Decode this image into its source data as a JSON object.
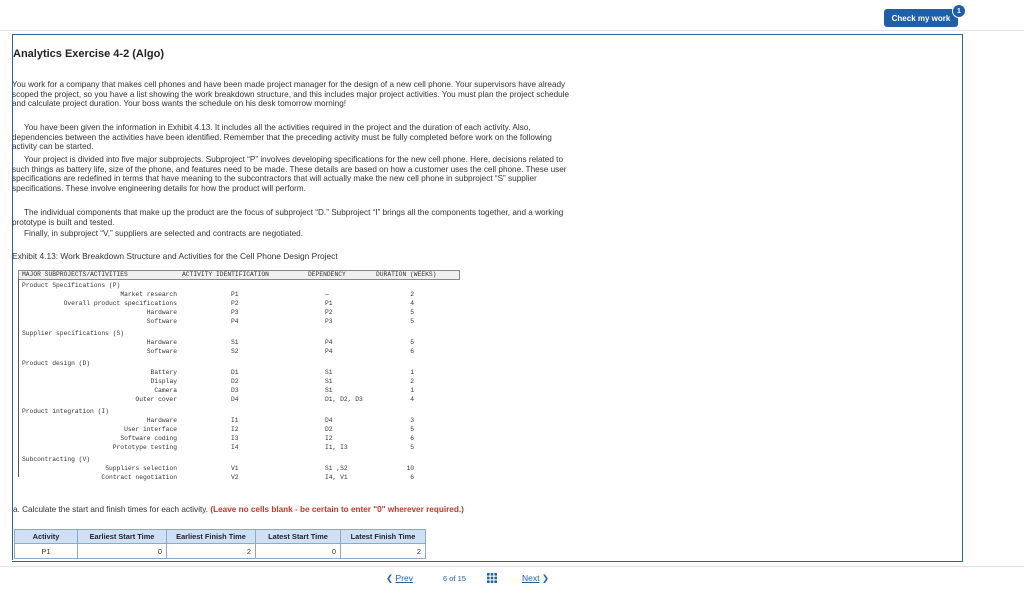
{
  "header": {
    "check_label": "Check my work",
    "badge_count": "1"
  },
  "title": "Analytics Exercise 4-2 (Algo)",
  "paragraphs": [
    "You work for a company that makes cell phones and have been made project manager for the design of a new cell phone. Your supervisors have already scoped the project, so you have a list showing the work breakdown structure, and this includes major project activities. You must plan the project schedule and calculate project duration. Your boss wants the schedule on his desk tomorrow morning!",
    "You have been given the information in Exhibit 4.13. It includes all the activities required in the project and the duration of each activity. Also, dependencies between the activities have been identified. Remember that the preceding activity must be fully completed before work on the following activity can be started.",
    "Your project is divided into five major subprojects. Subproject “P” involves developing specifications for the new cell phone. Here, decisions related to such things as battery life, size of the phone, and features need to be made. These details are based on how a customer uses the cell phone. These user specifications are redefined in terms that have meaning to the subcontractors that will actually make the new cell phone in subproject “S” supplier specifications. These involve engineering details for how the product will perform.",
    "The individual components that make up the product are the focus of subproject “D.” Subproject “I” brings all the components together, and a working prototype is built and tested.",
    "Finally, in subproject “V,” suppliers are selected and contracts are negotiated."
  ],
  "exhibit": {
    "caption": "Exhibit 4.13: Work Breakdown Structure and Activities for the Cell Phone Design Project",
    "headers": [
      "MAJOR SUBPROJECTS/ACTIVITIES",
      "ACTIVITY IDENTIFICATION",
      "DEPENDENCY",
      "DURATION (WEEKS)"
    ],
    "rows": [
      {
        "name": "Product Specifications (P)",
        "group": true
      },
      {
        "name": "Market research",
        "id": "P1",
        "dep": "—",
        "dur": "2"
      },
      {
        "name": "Overall product specifications",
        "id": "P2",
        "dep": "P1",
        "dur": "4"
      },
      {
        "name": "Hardware",
        "id": "P3",
        "dep": "P2",
        "dur": "5"
      },
      {
        "name": "Software",
        "id": "P4",
        "dep": "P3",
        "dur": "5"
      },
      {
        "name": "Supplier specifications (S)",
        "group": true
      },
      {
        "name": "Hardware",
        "id": "S1",
        "dep": "P4",
        "dur": "5"
      },
      {
        "name": "Software",
        "id": "S2",
        "dep": "P4",
        "dur": "6"
      },
      {
        "name": "Product design (D)",
        "group": true
      },
      {
        "name": "Battery",
        "id": "D1",
        "dep": "S1",
        "dur": "1"
      },
      {
        "name": "Display",
        "id": "D2",
        "dep": "S1",
        "dur": "2"
      },
      {
        "name": "Camera",
        "id": "D3",
        "dep": "S1",
        "dur": "1"
      },
      {
        "name": "Outer cover",
        "id": "D4",
        "dep": "D1, D2, D3",
        "dur": "4"
      },
      {
        "name": "Product integration (I)",
        "group": true
      },
      {
        "name": "Hardware",
        "id": "I1",
        "dep": "D4",
        "dur": "3"
      },
      {
        "name": "User interface",
        "id": "I2",
        "dep": "D2",
        "dur": "5"
      },
      {
        "name": "Software coding",
        "id": "I3",
        "dep": "I2",
        "dur": "6"
      },
      {
        "name": "Prototype testing",
        "id": "I4",
        "dep": "I1, I3",
        "dur": "5"
      },
      {
        "name": "Subcontracting (V)",
        "group": true
      },
      {
        "name": "Suppliers selection",
        "id": "V1",
        "dep": "S1 ,S2",
        "dur": "10"
      },
      {
        "name": "Contract negotiation",
        "id": "V2",
        "dep": "I4, V1",
        "dur": "6"
      }
    ]
  },
  "question": {
    "prefix": "a. Calculate the start and finish times for each activity.",
    "emphasis": "(Leave no cells blank - be certain to enter \"0\" wherever required.)"
  },
  "answer_table": {
    "headers": [
      "Activity",
      "Earliest Start Time",
      "Earliest Finish Time",
      "Latest Start Time",
      "Latest Finish Time"
    ],
    "rows": [
      {
        "activity": "P1",
        "es": "0",
        "ef": "2",
        "ls": "0",
        "lf": "2"
      }
    ]
  },
  "footer": {
    "prev_label": "Prev",
    "page_current": "6",
    "page_sep": "of",
    "page_total": "15",
    "next_label": "Next"
  }
}
